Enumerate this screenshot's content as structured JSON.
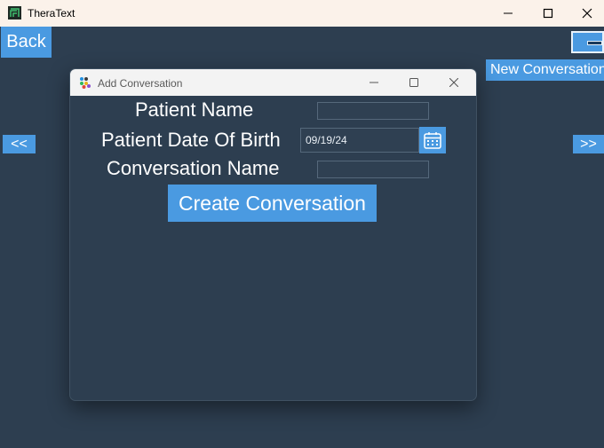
{
  "window": {
    "title": "TheraText"
  },
  "main": {
    "back_label": "Back",
    "prev_label": "<<",
    "next_label": ">>",
    "new_conversation_label": "New Conversation"
  },
  "dialog": {
    "title": "Add Conversation",
    "patient_name_label": "Patient Name",
    "patient_dob_label": "Patient Date Of Birth",
    "conversation_name_label": "Conversation Name",
    "patient_name_value": "",
    "dob_value": "09/19/24",
    "conversation_name_value": "",
    "create_label": "Create Conversation"
  },
  "colors": {
    "background": "#2d3e50",
    "accent": "#4a9ae1",
    "titlebar": "#fbf2ea"
  }
}
